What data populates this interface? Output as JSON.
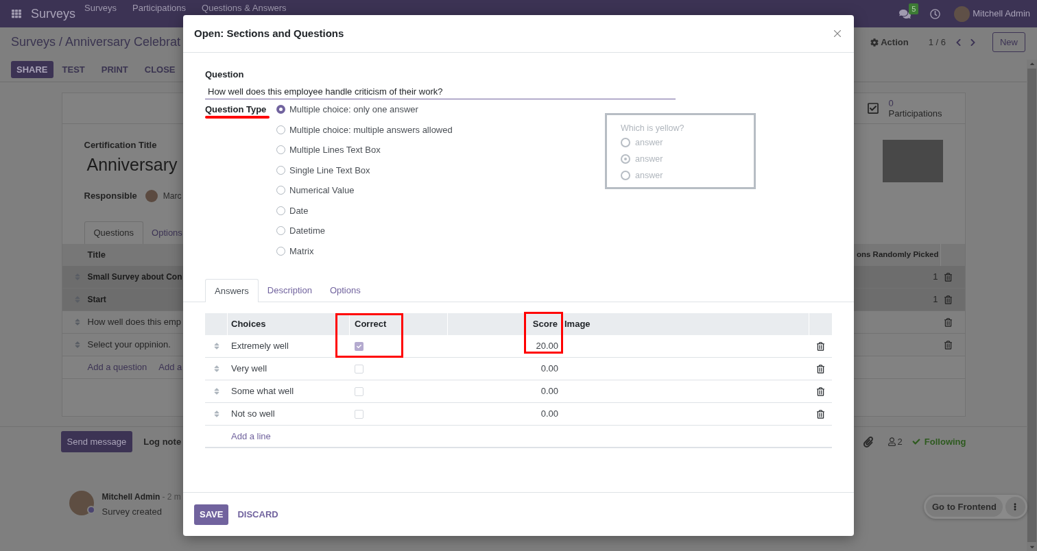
{
  "navbar": {
    "app_name": "Surveys",
    "menu": [
      "Surveys",
      "Participations",
      "Questions & Answers"
    ],
    "messages_badge": "5",
    "user": "Mitchell Admin"
  },
  "control_panel": {
    "breadcrumb": "Surveys / Anniversary Celebrat",
    "buttons": [
      {
        "label": "SHARE",
        "kind": "primary"
      },
      {
        "label": "TEST",
        "kind": "link"
      },
      {
        "label": "PRINT",
        "kind": "link"
      },
      {
        "label": "CLOSE",
        "kind": "link"
      }
    ],
    "action": "Action",
    "pager": "1 / 6",
    "new_button": "New"
  },
  "form": {
    "stat_button": {
      "value": "0",
      "label": "Participations"
    },
    "title_label": "Certification Title",
    "title": "Anniversary",
    "responsible_label": "Responsible",
    "responsible": "Marc",
    "tabs": [
      {
        "label": "Questions",
        "selected": true
      },
      {
        "label": "Options",
        "selected": false
      }
    ],
    "table": {
      "columns": [
        "Title",
        "ons Randomly Picked"
      ],
      "rows": [
        {
          "kind": "section",
          "title": "Small Survey about Con",
          "randomly_picked": "1"
        },
        {
          "kind": "section",
          "title": "Start",
          "randomly_picked": "1"
        },
        {
          "kind": "question",
          "title": "How well does this emp"
        },
        {
          "kind": "question",
          "title": "Select your oppinion."
        }
      ],
      "add_links": [
        "Add a question",
        "Add a"
      ]
    }
  },
  "chatter": {
    "send_message": "Send message",
    "log_note": "Log note",
    "followers": "2",
    "following": "Following",
    "messages": [
      {
        "author": "Mitchell Admin",
        "time": "- 2 m",
        "body": "Survey created"
      }
    ]
  },
  "frontend_button": "Go to Frontend",
  "dialog": {
    "title": "Open: Sections and Questions",
    "question_label": "Question",
    "question": "How well does this employee handle criticism of their work?",
    "question_type": {
      "label": "Question Type",
      "highlighted": true,
      "options": [
        {
          "label": "Multiple choice: only one answer",
          "selected": true
        },
        {
          "label": "Multiple choice: multiple answers allowed",
          "selected": false
        },
        {
          "label": "Multiple Lines Text Box",
          "selected": false
        },
        {
          "label": "Single Line Text Box",
          "selected": false
        },
        {
          "label": "Numerical Value",
          "selected": false
        },
        {
          "label": "Date",
          "selected": false
        },
        {
          "label": "Datetime",
          "selected": false
        },
        {
          "label": "Matrix",
          "selected": false
        }
      ]
    },
    "preview": {
      "question": "Which is yellow?",
      "answers": [
        {
          "label": "answer",
          "selected": false
        },
        {
          "label": "answer",
          "selected": true
        },
        {
          "label": "answer",
          "selected": false
        }
      ]
    },
    "tabs": [
      {
        "label": "Answers",
        "selected": true
      },
      {
        "label": "Description",
        "selected": false
      },
      {
        "label": "Options",
        "selected": false
      }
    ],
    "answers": {
      "columns": [
        {
          "label": "Choices",
          "highlighted": false
        },
        {
          "label": "Correct",
          "highlighted": true
        },
        {
          "label": "Score",
          "highlighted": true
        },
        {
          "label": "Image",
          "highlighted": false
        }
      ],
      "rows": [
        {
          "choice": "Extremely well",
          "correct": true,
          "score": "20.00"
        },
        {
          "choice": "Very well",
          "correct": false,
          "score": "0.00"
        },
        {
          "choice": "Some what well",
          "correct": false,
          "score": "0.00"
        },
        {
          "choice": "Not so well",
          "correct": false,
          "score": "0.00"
        }
      ],
      "add_line": "Add a line"
    },
    "buttons": [
      {
        "label": "SAVE",
        "kind": "primary"
      },
      {
        "label": "DISCARD",
        "kind": "link"
      }
    ]
  }
}
